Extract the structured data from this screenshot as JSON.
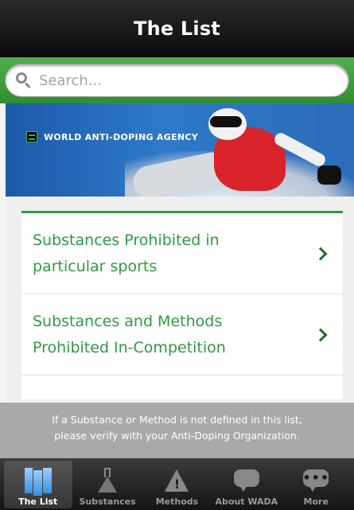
{
  "header": {
    "title": "The List"
  },
  "search": {
    "placeholder": "Search..."
  },
  "banner": {
    "agency_name": "WORLD ANTI-DOPING AGENCY"
  },
  "list": {
    "items": [
      {
        "label": "Substances Prohibited in particular sports"
      },
      {
        "label": "Substances and Methods Prohibited In-Competition"
      }
    ]
  },
  "notice": {
    "line1": "If a Substance or Method is not defined in this list,",
    "line2": "please verify with your Anti-Doping Organization."
  },
  "tabbar": {
    "tabs": [
      {
        "label": "The List",
        "icon": "map-icon",
        "active": true
      },
      {
        "label": "Substances",
        "icon": "flask-icon",
        "active": false
      },
      {
        "label": "Methods",
        "icon": "warning-icon",
        "active": false
      },
      {
        "label": "About WADA",
        "icon": "speech-bubble-icon",
        "active": false
      },
      {
        "label": "More",
        "icon": "more-bubble-icon",
        "active": false
      }
    ]
  },
  "colors": {
    "brand_green": "#2e9a3f",
    "search_green": "#3fa03a",
    "notice_gray": "#a9a9a9"
  }
}
